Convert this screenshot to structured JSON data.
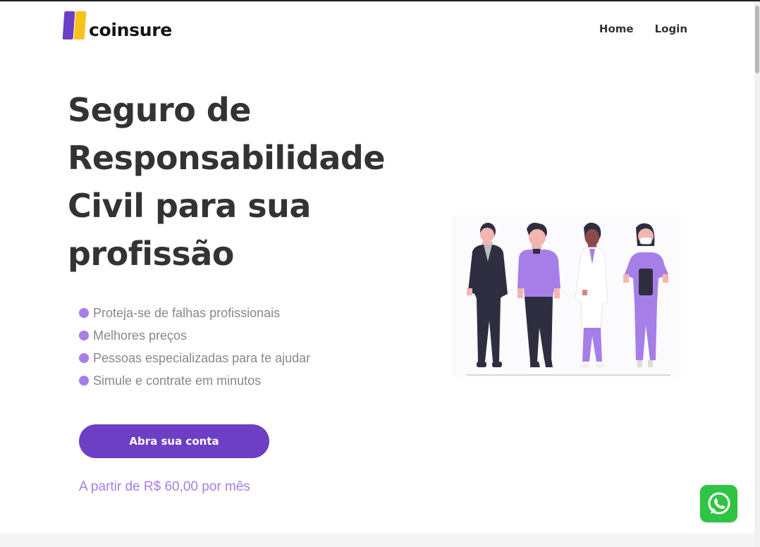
{
  "header": {
    "logo_text": "coinsure",
    "nav": [
      {
        "label": "Home"
      },
      {
        "label": "Login"
      }
    ]
  },
  "hero": {
    "title": "Seguro de Responsabilidade Civil para sua profissão",
    "benefits": [
      "Proteja-se de falhas profissionais",
      "Melhores preços",
      "Pessoas especializadas para te ajudar",
      "Simule e contrate em minutos"
    ],
    "cta_label": "Abra sua conta",
    "price_text": "A partir de R$ 60,00 por mês"
  },
  "colors": {
    "brand_purple": "#6c3fc5",
    "brand_yellow": "#f7c21a",
    "accent_lavender": "#a67ee8",
    "whatsapp_green": "#2fc443"
  },
  "icons": {
    "floating_button": "whatsapp-icon"
  }
}
